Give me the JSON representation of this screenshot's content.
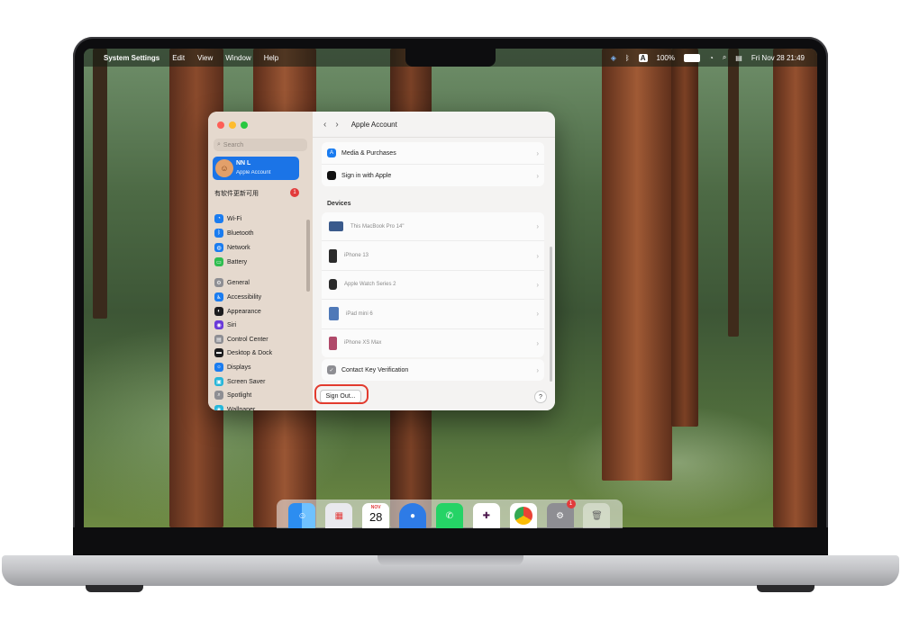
{
  "menubar": {
    "apple": "",
    "app_name": "System Settings",
    "menus": [
      "Edit",
      "View",
      "Window",
      "Help"
    ],
    "battery_pct": "100%",
    "input_source": "A",
    "clock": "Fri Nov 28  21:49"
  },
  "window": {
    "title": "Apple Account",
    "nav_back": "‹",
    "nav_forward": "›",
    "search_placeholder": "Search",
    "account": {
      "name": "NN L",
      "subtitle": "Apple Account"
    },
    "update": {
      "label": "有软件更新可用",
      "count": "1"
    },
    "sidebar_items": [
      {
        "label": "Wi-Fi",
        "icon": "wifi-icon",
        "color": "#1a7cf0",
        "glyph": "◔"
      },
      {
        "label": "Bluetooth",
        "icon": "bluetooth-icon",
        "color": "#1a7cf0",
        "glyph": "ᛒ"
      },
      {
        "label": "Network",
        "icon": "globe-icon",
        "color": "#1a7cf0",
        "glyph": "◍"
      },
      {
        "label": "Battery",
        "icon": "battery-icon",
        "color": "#2fbd4f",
        "glyph": "▭"
      },
      {
        "label": "General",
        "icon": "gear-icon",
        "color": "#8e8e93",
        "glyph": "⚙"
      },
      {
        "label": "Accessibility",
        "icon": "accessibility-icon",
        "color": "#1a7cf0",
        "glyph": "♿"
      },
      {
        "label": "Appearance",
        "icon": "appearance-icon",
        "color": "#1c1c1e",
        "glyph": "◐"
      },
      {
        "label": "Siri",
        "icon": "siri-icon",
        "color": "#6b3ad9",
        "glyph": "◉"
      },
      {
        "label": "Control Center",
        "icon": "control-center-icon",
        "color": "#8e8e93",
        "glyph": "▤"
      },
      {
        "label": "Desktop & Dock",
        "icon": "desktop-dock-icon",
        "color": "#1c1c1e",
        "glyph": "▬"
      },
      {
        "label": "Displays",
        "icon": "displays-icon",
        "color": "#1a7cf0",
        "glyph": "☼"
      },
      {
        "label": "Screen Saver",
        "icon": "screen-saver-icon",
        "color": "#27b6d9",
        "glyph": "▣"
      },
      {
        "label": "Spotlight",
        "icon": "spotlight-icon",
        "color": "#8e8e93",
        "glyph": "⌕"
      },
      {
        "label": "Wallpaper",
        "icon": "wallpaper-icon",
        "color": "#27b6d9",
        "glyph": "❀"
      }
    ],
    "top_rows": [
      {
        "label": "Media & Purchases",
        "icon": "app-store-icon",
        "color": "#1a7cf0",
        "glyph": "A"
      },
      {
        "label": "Sign in with Apple",
        "icon": "apple-logo-icon",
        "color": "#111111",
        "glyph": ""
      }
    ],
    "devices_heading": "Devices",
    "devices": [
      {
        "label": "This MacBook Pro 14\"",
        "icon": "macbook-icon"
      },
      {
        "label": "iPhone 13",
        "icon": "iphone-icon"
      },
      {
        "label": "Apple Watch Series 2",
        "icon": "apple-watch-icon"
      },
      {
        "label": "iPad mini 6",
        "icon": "ipad-icon"
      },
      {
        "label": "iPhone XS Max",
        "icon": "iphone-icon"
      }
    ],
    "contact_key": {
      "label": "Contact Key Verification",
      "icon": "key-verification-icon"
    },
    "sign_out": "Sign Out...",
    "help": "?"
  },
  "dock": {
    "calendar_month": "NOV",
    "calendar_day": "28",
    "settings_badge": "1",
    "apps": [
      "finder-icon",
      "launchpad-icon",
      "calendar-icon",
      "app-icon",
      "whatsapp-icon",
      "slack-icon",
      "chrome-icon",
      "system-settings-icon",
      "trash-icon"
    ]
  },
  "colors": {
    "accent": "#1b74e7",
    "highlight_ring": "#e23b2e",
    "sidebar_bg": "#e5d9ce"
  }
}
